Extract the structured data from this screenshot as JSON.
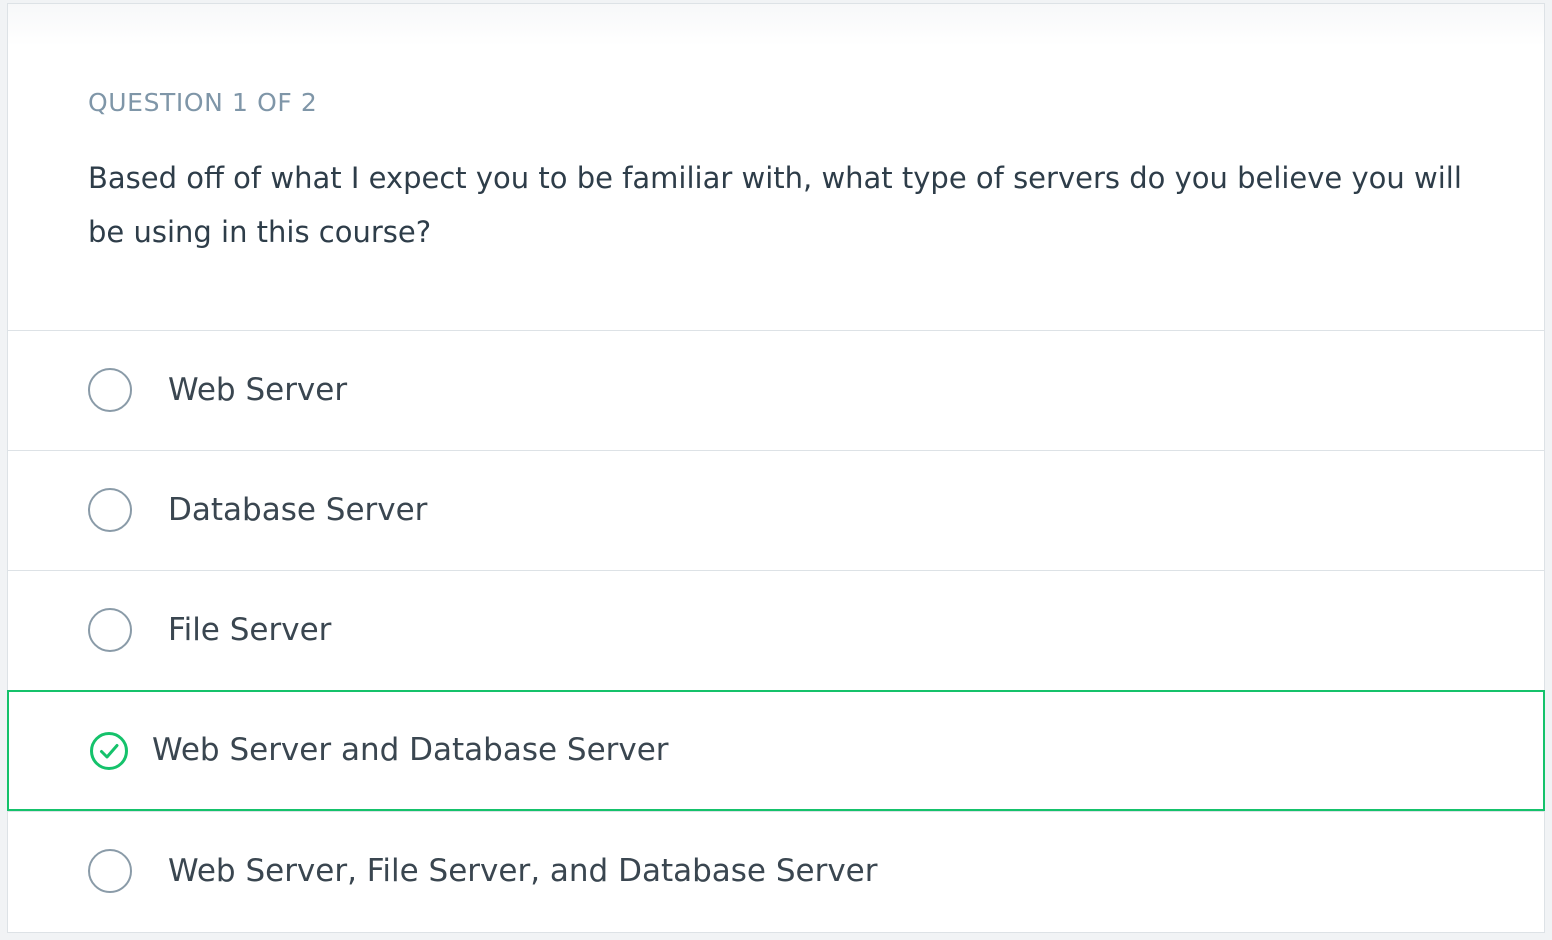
{
  "quiz": {
    "question_counter": "QUESTION 1 OF 2",
    "question_text": "Based off of what I expect you to be familiar with, what type of servers do you believe you will be using in this course?",
    "options": [
      {
        "label": "Web Server",
        "selected": false
      },
      {
        "label": "Database Server",
        "selected": false
      },
      {
        "label": "File Server",
        "selected": false
      },
      {
        "label": "Web Server and Database Server",
        "selected": true
      },
      {
        "label": "Web Server, File Server, and Database Server",
        "selected": false
      }
    ]
  },
  "colors": {
    "selected_accent": "#15c26b",
    "counter_text": "#7f96a8",
    "question_text": "#2e3d49",
    "radio_border": "#8a9ba8",
    "divider": "#dde2e6"
  },
  "icons": {
    "unselected": "radio-empty-icon",
    "selected": "check-circle-icon"
  }
}
